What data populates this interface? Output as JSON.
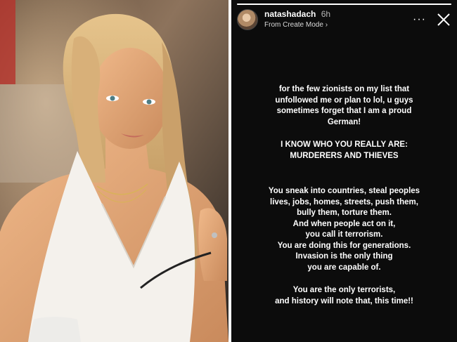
{
  "story": {
    "username": "natashadach",
    "timestamp": "6h",
    "subtitle": "From Create Mode",
    "chevron": "›",
    "more_glyph": "···",
    "progress": 1.0,
    "paragraphs": [
      {
        "lines": [
          "for the few zionists on my list that",
          "unfollowed me or plan to lol, u guys",
          "sometimes forget that I am a proud",
          "German!"
        ]
      },
      {
        "lines": [
          "I KNOW WHO YOU REALLY ARE:",
          "MURDERERS AND THIEVES"
        ]
      },
      {
        "lines": [
          "You sneak into countries, steal peoples",
          "lives, jobs, homes, streets, push them,",
          "bully them, torture them.",
          "And when people act on it,",
          "you call it terrorism.",
          "You are doing this for generations.",
          "Invasion is the only thing",
          "you are capable of."
        ]
      },
      {
        "lines": [
          "You are the only terrorists,",
          "and history will note that, this time!!"
        ]
      }
    ]
  },
  "icons": {
    "more": "more-options-icon",
    "close": "close-icon",
    "avatar": "profile-avatar"
  },
  "colors": {
    "story_background": "#0c0c0c",
    "text": "#ffffff",
    "muted": "#b5b5b5"
  }
}
